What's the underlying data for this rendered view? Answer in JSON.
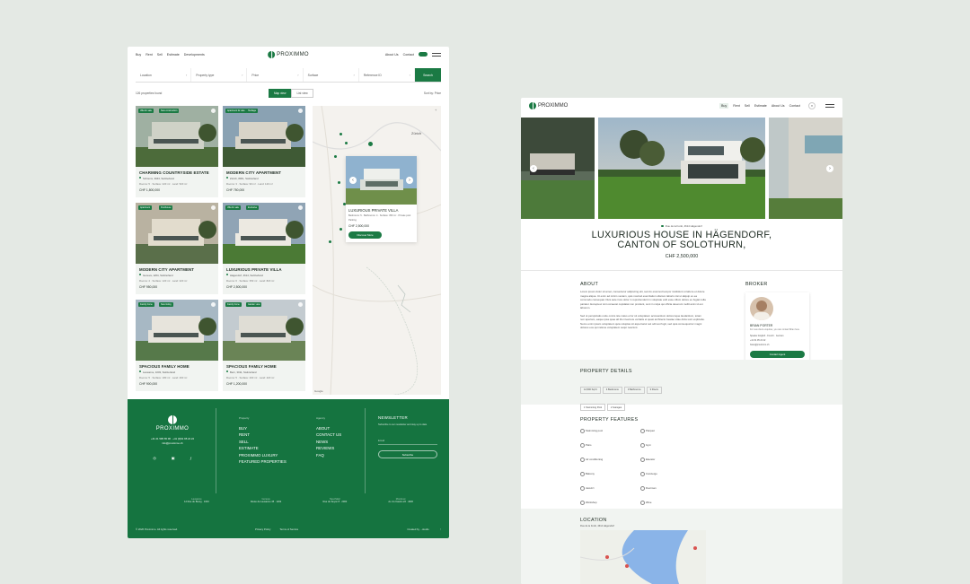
{
  "search_page": {
    "nav": {
      "left": [
        "Buy",
        "Rent",
        "Sell",
        "Estimate",
        "Developments"
      ],
      "right": [
        "About Us",
        "Contact"
      ],
      "brand": "PROXIMMO"
    },
    "search": {
      "fields": [
        "Location",
        "Property type",
        "Price",
        "Surface",
        "Reference ID"
      ],
      "button": "Search"
    },
    "results": {
      "count": "126 properties found",
      "views": [
        "Map view",
        "List view"
      ],
      "sort": "Sort by: Price"
    },
    "cards": [
      {
        "tags": [
          "Villa for sale",
          "New construction"
        ],
        "title": "CHARMING COUNTRYSIDE ESTATE",
        "location": "Schrems, 3943, Switzerland",
        "specs": "Rooms: 5 · Surface: 220 m² · Land: 520 m²",
        "price": "CHF 1,800,000"
      },
      {
        "tags": [
          "Apartment for sale",
          "Heritage"
        ],
        "title": "MODERN CITY APARTMENT",
        "location": "Zürich, 8001, Switzerland",
        "specs": "Rooms: 3 · Surface: 90 m² · Land: 120 m²",
        "price": "CHF 750,000"
      },
      {
        "tags": [
          "Apartment",
          "Penthouse"
        ],
        "title": "MODERN CITY APARTMENT",
        "location": "Geneva, 1204, Switzerland",
        "specs": "Rooms: 4 · Surface: 120 m² · Land: 220 m²",
        "price": "CHF 950,000"
      },
      {
        "tags": [
          "Villa for sale",
          "Exclusive"
        ],
        "title": "LUXURIOUS PRIVATE VILLA",
        "location": "Hägendorf, 4614, Switzerland",
        "specs": "Rooms: 6 · Surface: 350 m² · Land: 820 m²",
        "price": "CHF 2,500,000"
      },
      {
        "tags": [
          "Family home",
          "New listing"
        ],
        "title": "SPACIOUS FAMILY HOME",
        "location": "Lausanne, 1003, Switzerland",
        "specs": "Rooms: 5 · Surface: 180 m² · Land: 400 m²",
        "price": "CHF 900,000"
      },
      {
        "tags": [
          "Family home",
          "Garden view"
        ],
        "title": "SPACIOUS FAMILY HOME",
        "location": "Bern, 3011, Switzerland",
        "specs": "Rooms: 5 · Surface: 200 m² · Land: 420 m²",
        "price": "CHF 1,200,000"
      }
    ],
    "map": {
      "city": "Zürich",
      "popup_title": "LUXURIOUS PRIVATE VILLA",
      "popup_specs": "Bedrooms: 5 · Bathrooms: 4 · Surface: 350 m² · Private pool",
      "popup_specs2": "Parking",
      "popup_price": "CHF 2,500,000",
      "popup_button": "Discover More",
      "credit": "Google"
    },
    "footer": {
      "brand": "PROXIMMO",
      "phone": "+41 21 595 65 08 · +41 (0)61 95 22 22",
      "email": "info@proximmo.ch",
      "col1_head": "Property",
      "col1": [
        "BUY",
        "RENT",
        "SELL",
        "ESTIMATE",
        "PROXIMMO LUXURY",
        "FEATURED PROPERTIES"
      ],
      "col2_head": "Agency",
      "col2": [
        "ABOUT",
        "CONTACT US",
        "NEWS",
        "REVIEWS",
        "FAQ"
      ],
      "news_head": "NEWSLETTER",
      "news_text": "Subscribe to our newsletter and stay up to date",
      "news_input": "Email",
      "news_button": "Subscribe",
      "offices": [
        {
          "city": "Lausanne",
          "addr": "12 Rue du Bourg · 1003"
        },
        {
          "city": "Geneva",
          "addr": "Route de Lausanne 45 · 1202"
        },
        {
          "city": "Neuchâtel",
          "addr": "Rue du Seyon 8 · 2000"
        },
        {
          "city": "Montreux",
          "addr": "Av. du Casino 22 · 1820"
        }
      ],
      "copyright": "© 2026 Proximmo. All rights reserved.",
      "legal": [
        "Privacy Policy",
        "Terms of Service"
      ],
      "credit": "Created by ...studio"
    }
  },
  "detail_page": {
    "nav": {
      "links": [
        "Buy",
        "Rent",
        "Sell",
        "Estimate",
        "About Us",
        "Contact"
      ],
      "brand": "PROXIMMO"
    },
    "location": "Rue de la Forêt, 4614 Hägendorf",
    "title": "LUXURIOUS HOUSE IN HÄGENDORF, CANTON OF SOLOTHURN,",
    "price": "CHF 2,500,000",
    "about_head": "ABOUT",
    "about1": "Lorem ipsum dolor sit amet, consectetur adipiscing elit, sed do eiusmod tempor incididunt ut labore et dolore magna aliqua. Ut enim ad minim veniam, quis nostrud exercitation ullamco laboris nisi ut aliquip ex ea commodo consequat. Duis aute irure dolor in reprehenderit in voluptate velit esse cillum dolore eu fugiat nulla pariatur. Excepteur sint occaecat cupidatat non proident, sunt in culpa qui officia deserunt mollit anim id est laborum.",
    "about2": "Sed ut perspiciatis unde omnis iste natus error sit voluptatem accusantium doloremque laudantium, totam rem aperiam, eaque ipsa quae ab illo inventore veritatis et quasi architecto beatae vitae dicta sunt explicabo. Nemo enim ipsam voluptatem quia voluptas sit aspernatur aut odit aut fugit, sed quia consequuntur magni dolores eos qui ratione voluptatem sequi nesciunt.",
    "details_head": "PROPERTY DETAILS",
    "details": [
      "12,500 Sq Ft",
      "4 Bedrooms",
      "3 Bathrooms",
      "3 Floors",
      "1 Swimming Pool",
      "2 Garages"
    ],
    "features_head": "PROPERTY FEATURES",
    "features": [
      "Swimming pool",
      "Parquet",
      "Patio",
      "Gym",
      "Air conditioning",
      "Elevator",
      "Balcony",
      "Concierge",
      "Jacuzzi",
      "Doorman",
      "Workshop",
      "Wine"
    ],
    "loc_head": "LOCATION",
    "loc_addr": "Rue de la Forêt, 4614 Hägendorf",
    "broker_head": "BROKER",
    "broker_name": "BRIAN PORTER",
    "broker_sub": "For new client enquiries, you can contact Brian here.",
    "broker_langs": "Speaks: English · French · German",
    "broker_phone": "+41 61 95 22 22",
    "broker_email": "brian@proximmo.ch",
    "broker_btn": "Contact Agent"
  },
  "colors": {
    "brand_green": "#1b7a44",
    "footer_green": "#157440",
    "background": "#e4e9e4"
  }
}
